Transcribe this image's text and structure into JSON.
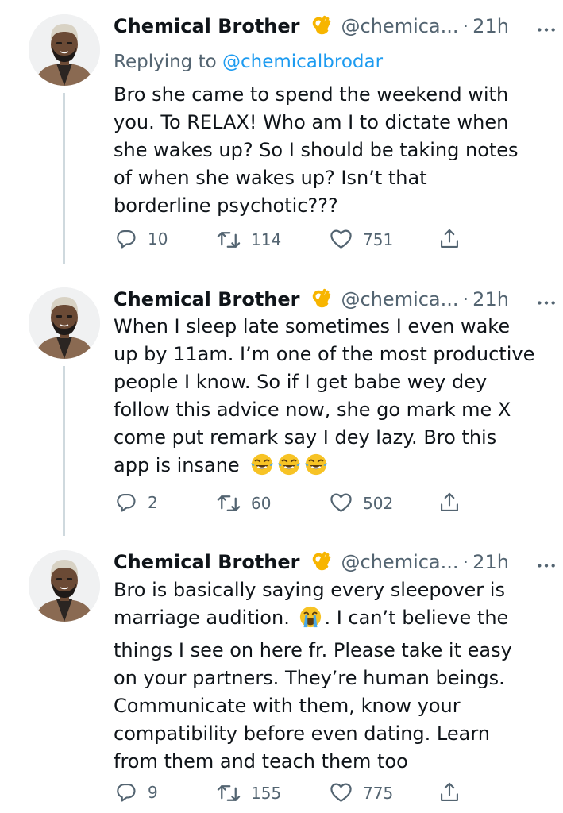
{
  "tweets": [
    {
      "name": "Chemical Brother",
      "handle": "@chemica...",
      "dot": "·",
      "time": "21h",
      "more": "···",
      "replying_prefix": "Replying to",
      "replying_to": "@chemicalbrodar",
      "text_lines": [
        "Bro she came to spend the weekend with",
        "you. To RELAX! Who am I to dictate when",
        "she wakes up? So I should be taking notes",
        "of when she wakes up? Isn’t that",
        "borderline psychotic???"
      ],
      "replies": "10",
      "retweets": "114",
      "likes": "751"
    },
    {
      "name": "Chemical Brother",
      "handle": "@chemica...",
      "dot": "·",
      "time": "21h",
      "more": "···",
      "text_lines": [
        "When I sleep late sometimes I even wake",
        "up by 11am. I’m one of the most productive",
        "people I know. So if I get babe wey dey",
        "follow this advice now, she go mark me X",
        "come put remark say I dey lazy. Bro this",
        "app is insane"
      ],
      "trailing_emojis": [
        "face-with-tears-of-joy",
        "face-with-tears-of-joy",
        "face-with-tears-of-joy"
      ],
      "replies": "2",
      "retweets": "60",
      "likes": "502"
    },
    {
      "name": "Chemical Brother",
      "handle": "@chemica...",
      "dot": "·",
      "time": "21h",
      "more": "···",
      "text_lines": [
        "Bro is basically saying every sleepover is",
        "marriage audition.",
        ". I can’t believe the",
        "things I see on here fr. Please take it easy",
        "on your partners. They’re human beings.",
        "Communicate with them, know your",
        "compatibility before even dating. Learn",
        "from them and teach them too"
      ],
      "inline_emoji": "loudly-crying-face",
      "replies": "9",
      "retweets": "155",
      "likes": "775"
    }
  ],
  "icons": {
    "verified_badge": "ok-hand-emoji",
    "reply": "reply-icon",
    "retweet": "retweet-icon",
    "like": "heart-icon",
    "share": "share-icon",
    "more": "more-icon"
  },
  "colors": {
    "text": "#0f1419",
    "secondary": "#536471",
    "link": "#1d9bf0",
    "thread_line": "#cfd9de"
  }
}
